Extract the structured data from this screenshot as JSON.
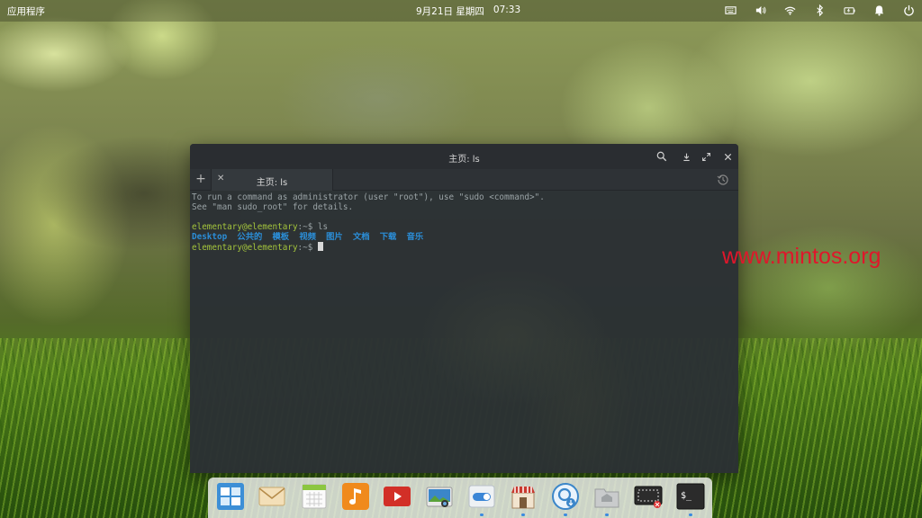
{
  "panel": {
    "applications_label": "应用程序",
    "date": "9月21日 星期四",
    "time": "07:33",
    "indicators": [
      "keyboard-icon",
      "volume-icon",
      "wifi-icon",
      "bluetooth-icon",
      "battery-icon",
      "notifications-icon",
      "power-icon"
    ]
  },
  "window": {
    "title": "主页: ls",
    "tab_label": "主页: ls",
    "buttons": [
      "search-icon",
      "export-icon",
      "maximize-icon",
      "close-icon"
    ]
  },
  "terminal": {
    "line1": "To run a command as administrator (user \"root\"), use \"sudo <command>\".",
    "line2": "See \"man sudo_root\" for details.",
    "prompt1": "elementary@elementary",
    "prompt1_suffix": ":~$ ls",
    "dirs": [
      "Desktop",
      "公共的",
      "模板",
      "视频",
      "图片",
      "文档",
      "下载",
      "音乐"
    ],
    "prompt2": "elementary@elementary",
    "prompt2_suffix": ":~$ "
  },
  "watermark": "www.mintos.org",
  "dock": {
    "items": [
      {
        "name": "multitasking-view",
        "color": "#3d8fd6"
      },
      {
        "name": "mail",
        "color": "#e8d0a4"
      },
      {
        "name": "calendar",
        "color": "#f1f1f1"
      },
      {
        "name": "music",
        "color": "#f08a1c"
      },
      {
        "name": "videos",
        "color": "#d22f27"
      },
      {
        "name": "photos",
        "color": "#3b86c9"
      },
      {
        "name": "switchboard-settings",
        "color": "#e8edf2"
      },
      {
        "name": "appcenter",
        "color": "#c7a174"
      },
      {
        "name": "epiphany-browser",
        "color": "#5aa7e8"
      },
      {
        "name": "files",
        "color": "#c9cbcc"
      },
      {
        "name": "screenshot",
        "color": "#2c2c2c"
      },
      {
        "name": "terminal",
        "color": "#2b2b2b"
      }
    ],
    "running": [
      "switchboard-settings",
      "appcenter",
      "epiphany-browser",
      "files",
      "terminal"
    ]
  }
}
